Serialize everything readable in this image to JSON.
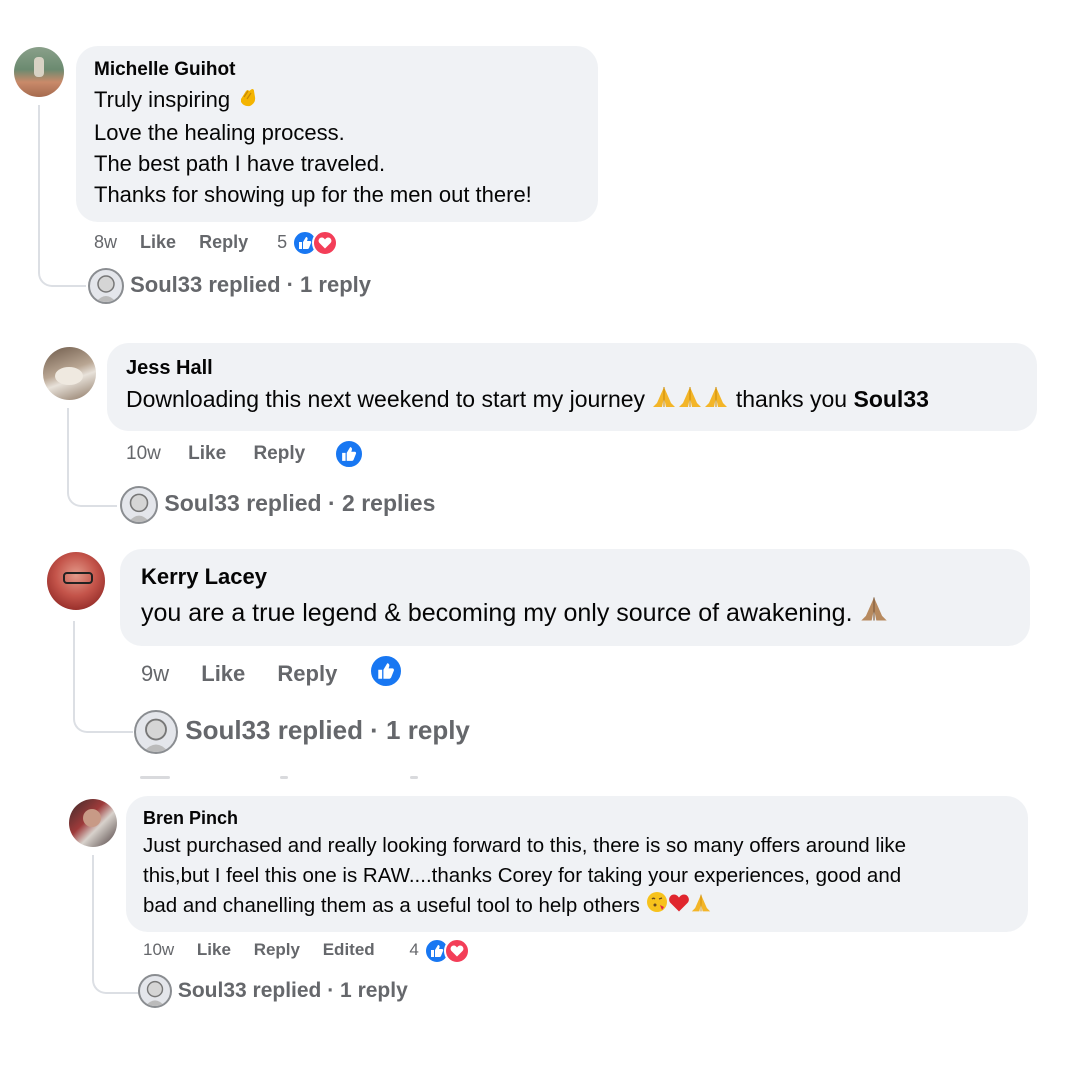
{
  "comments": [
    {
      "name": "Michelle Guihot",
      "lines": [
        "Truly inspiring",
        "Love the healing process.",
        "The best path I have traveled.",
        "Thanks for showing up for the men out there!"
      ],
      "emoji": [
        "clapping-hands"
      ],
      "time": "8w",
      "like_label": "Like",
      "reply_label": "Reply",
      "reaction_count": "5",
      "reactions": [
        "like",
        "love"
      ],
      "replied_text": "Soul33 replied · 1 reply"
    },
    {
      "name": "Jess Hall",
      "text_before": "Downloading this next weekend to start my journey",
      "text_after": "thanks you",
      "mention": "Soul33",
      "emoji": [
        "folded-hands",
        "folded-hands",
        "folded-hands"
      ],
      "time": "10w",
      "like_label": "Like",
      "reply_label": "Reply",
      "reactions": [
        "like"
      ],
      "replied_text": "Soul33 replied · 2 replies"
    },
    {
      "name": "Kerry Lacey",
      "text": "you are a true legend & becoming my only source of awakening.",
      "emoji": [
        "folded-hands"
      ],
      "time": "9w",
      "like_label": "Like",
      "reply_label": "Reply",
      "reactions": [
        "like"
      ],
      "replied_text": "Soul33 replied · 1 reply"
    },
    {
      "name": "Bren Pinch",
      "lines": [
        "Just purchased and really looking forward to this, there is so many offers around like",
        "this,but I feel this one is RAW....thanks Corey for taking your experiences, good and",
        "bad and chanelling them as a useful tool to help others"
      ],
      "emoji": [
        "face-blowing-kiss",
        "red-heart",
        "folded-hands"
      ],
      "time": "10w",
      "like_label": "Like",
      "reply_label": "Reply",
      "edited_label": "Edited",
      "reaction_count": "4",
      "reactions": [
        "like",
        "love"
      ],
      "replied_text": "Soul33 replied · 1 reply"
    }
  ],
  "colors": {
    "bubble": "#f0f2f5",
    "meta": "#65676b",
    "like": "#1877f2",
    "love": "#f33e58",
    "thread_line": "#dcdfe4"
  }
}
